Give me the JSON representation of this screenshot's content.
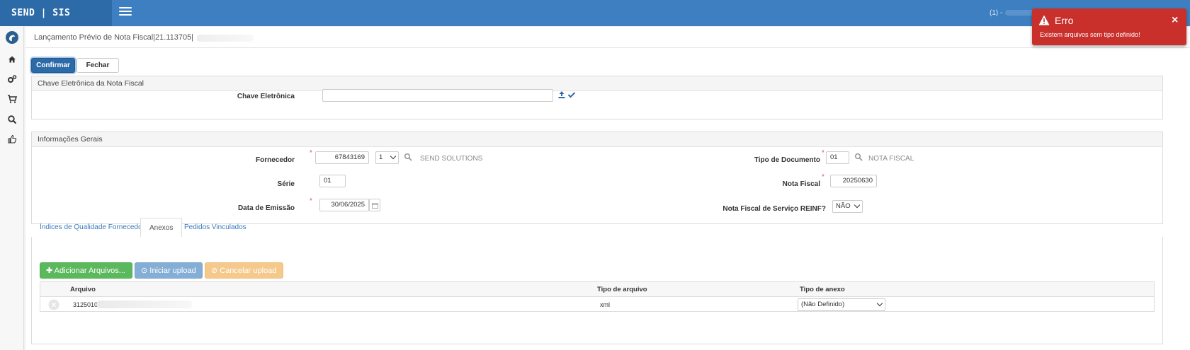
{
  "brand": "SEND | SIS",
  "topbar": {
    "user_prefix": "(1) -"
  },
  "page": {
    "title": "Lançamento Prévio de Nota Fiscal|21.113705|"
  },
  "actions": {
    "confirm_label": "Confirmar",
    "close_label": "Fechar"
  },
  "chave_panel": {
    "header": "Chave Eletrônica da Nota Fiscal",
    "chave_label": "Chave Eletrônica",
    "chave_value": ""
  },
  "info_panel": {
    "header": "Informações Gerais",
    "fornecedor_label": "Fornecedor",
    "fornecedor_code": "67843169",
    "fornecedor_branch": "1",
    "fornecedor_name": "SEND SOLUTIONS",
    "serie_label": "Série",
    "serie_value": "01",
    "data_emissao_label": "Data de Emissão",
    "data_emissao_value": "30/06/2025",
    "tipo_documento_label": "Tipo de Documento",
    "tipo_documento_code": "01",
    "tipo_documento_name": "NOTA FISCAL",
    "nota_fiscal_label": "Nota Fiscal",
    "nota_fiscal_value": "20250630",
    "reinf_label": "Nota Fiscal de Serviço REINF?",
    "reinf_value": "NÃO"
  },
  "tabs": [
    {
      "label": "Índices de Qualidade Fornecedor"
    },
    {
      "label": "Anexos"
    },
    {
      "label": "Pedidos Vinculados"
    }
  ],
  "anexos": {
    "add_label": "Adicionar Arquivos...",
    "start_label": "Iniciar upload",
    "cancel_label": "Cancelar upload",
    "columns": [
      "Arquivo",
      "Tipo de arquivo",
      "Tipo de anexo"
    ],
    "rows": [
      {
        "arquivo": "3125010:",
        "tipo_arquivo": "xml",
        "tipo_anexo": "(Não Definido)"
      }
    ]
  },
  "toast": {
    "title": "Erro",
    "message": "Existem arquivos sem tipo definido!"
  },
  "colors": {
    "primary": "#3d7fc0",
    "error": "#c9302c",
    "success": "#5cb85c"
  }
}
